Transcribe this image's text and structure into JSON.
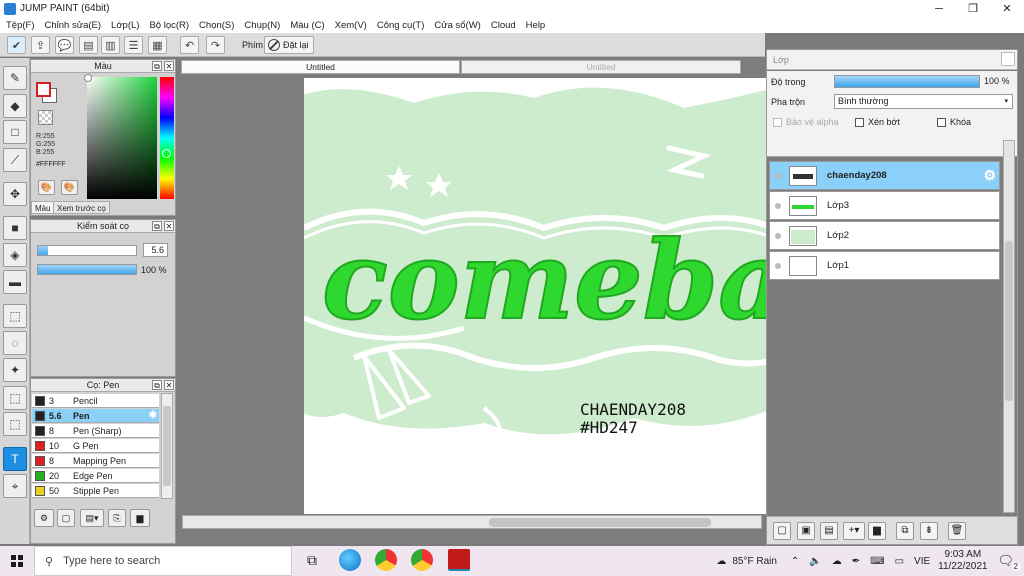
{
  "window": {
    "title": "JUMP PAINT (64bit)",
    "minimize": "─",
    "maximize": "❐",
    "close": "✕"
  },
  "menu": [
    "Tệp(F)",
    "Chỉnh sửa(E)",
    "Lớp(L)",
    "Bộ lọc(R)",
    "Chọn(S)",
    "Chụp(N)",
    "Màu (C)",
    "Xem(V)",
    "Công cụ(T)",
    "Cửa sổ(W)",
    "Cloud",
    "Help"
  ],
  "toolbar": {
    "pin_label": "Phím",
    "reset_label": "Đặt lại"
  },
  "tabs": {
    "active": "Untitled",
    "inactive": "Untitled"
  },
  "color_panel": {
    "title": "Màu",
    "r": "R:255",
    "g": "G:255",
    "b": "B:255",
    "hex": "#FFFFFF",
    "tab1": "Màu",
    "tab2": "Xem trước cọ"
  },
  "brush_control": {
    "title": "Kiểm soát cọ",
    "size": "5.6",
    "opacity": "100 %",
    "opacity_fraction": 1.0
  },
  "brush_panel": {
    "title": "Cọ: Pen",
    "items": [
      {
        "size": "3",
        "name": "Pencil",
        "color": "#222222"
      },
      {
        "size": "5.6",
        "name": "Pen",
        "color": "#222222",
        "selected": true
      },
      {
        "size": "8",
        "name": "Pen (Sharp)",
        "color": "#222222"
      },
      {
        "size": "10",
        "name": "G Pen",
        "color": "#e02020"
      },
      {
        "size": "8",
        "name": "Mapping Pen",
        "color": "#e02020"
      },
      {
        "size": "20",
        "name": "Edge Pen",
        "color": "#20b020"
      },
      {
        "size": "50",
        "name": "Stipple Pen",
        "color": "#e8d020"
      }
    ]
  },
  "canvas": {
    "word": "comeback",
    "tag1": "CHAENDAY208",
    "tag2": "#HD247",
    "accent": "#2fd82f",
    "wash": "#cdeccd"
  },
  "layers": {
    "title": "Lớp",
    "opacity_label": "Độ trong",
    "opacity": "100 %",
    "opacity_fraction": 1.0,
    "blend_label": "Pha trộn",
    "blend": "Bình thường",
    "protect_alpha": "Bảo vệ alpha",
    "clipping": "Xén bớt",
    "lock": "Khóa",
    "items": [
      {
        "name": "chaenday208",
        "selected": true
      },
      {
        "name": "Lớp3"
      },
      {
        "name": "Lớp2"
      },
      {
        "name": "Lớp1"
      }
    ]
  },
  "taskbar": {
    "search_placeholder": "Type here to search",
    "weather": "85°F Rain",
    "lang": "VIE",
    "time": "9:03 AM",
    "date": "11/22/2021",
    "notif": "2"
  }
}
